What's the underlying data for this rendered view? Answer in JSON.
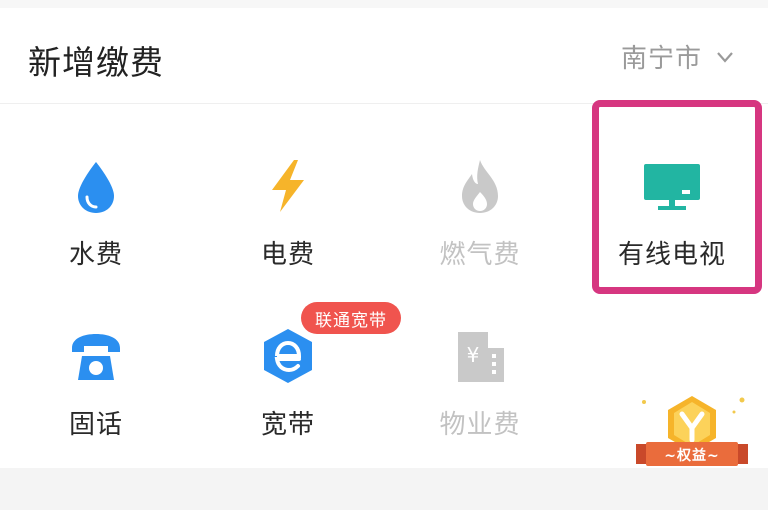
{
  "header": {
    "title": "新增缴费",
    "city": "南宁市",
    "city_dropdown_icon": "chevron-down-icon"
  },
  "services": [
    {
      "label": "水费",
      "icon": "water-drop-icon",
      "enabled": true,
      "color": "#2b8ff0"
    },
    {
      "label": "电费",
      "icon": "lightning-icon",
      "enabled": true,
      "color": "#f6b42a"
    },
    {
      "label": "燃气费",
      "icon": "flame-icon",
      "enabled": false,
      "color": "#c9c9c9"
    },
    {
      "label": "有线电视",
      "icon": "tv-icon",
      "enabled": true,
      "color": "#22b5a2",
      "highlighted": true
    },
    {
      "label": "固话",
      "icon": "telephone-icon",
      "enabled": true,
      "color": "#2b8ff0"
    },
    {
      "label": "宽带",
      "icon": "broadband-e-icon",
      "enabled": true,
      "color": "#2b8ff0",
      "badge": "联通宽带"
    },
    {
      "label": "物业费",
      "icon": "building-yen-icon",
      "enabled": false,
      "color": "#c9c9c9"
    }
  ],
  "benefit_badge": {
    "label": "~权益~",
    "icon": "crown-benefit-icon"
  },
  "colors": {
    "highlight_border": "#d63680",
    "badge_bg": "#f0544e"
  }
}
